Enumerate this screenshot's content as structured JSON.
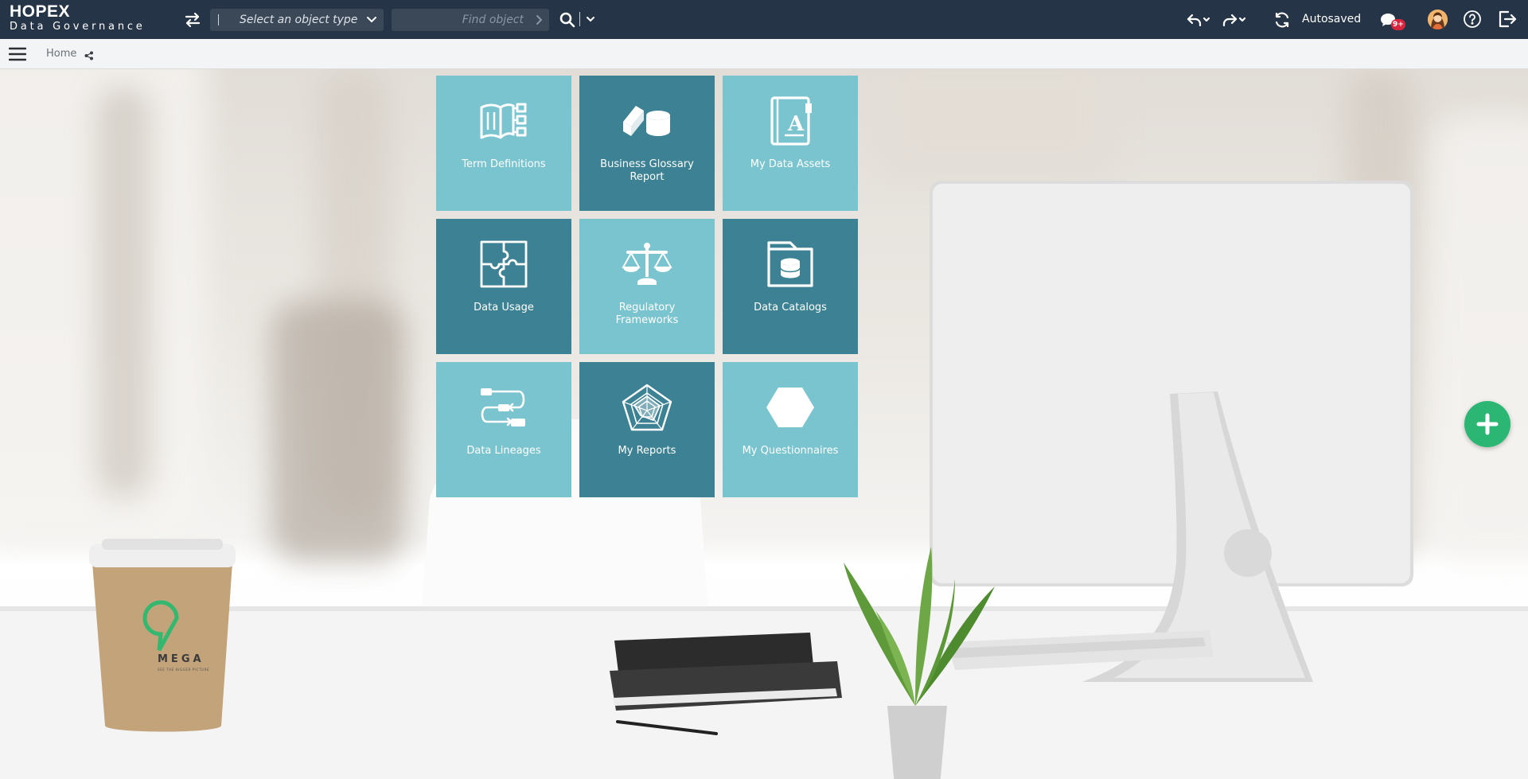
{
  "app": {
    "brand_name": "HOPEX",
    "brand_sub": "Data Governance"
  },
  "toolbar": {
    "object_type_placeholder": "Select an object type",
    "find_placeholder": "Find object",
    "autosaved_label": "Autosaved",
    "notification_badge": "9+"
  },
  "breadcrumb": {
    "home": "Home"
  },
  "tiles": [
    {
      "label": "Term Definitions",
      "icon": "book-list-icon",
      "shade": "light"
    },
    {
      "label": "Business Glossary Report",
      "icon": "books-database-icon",
      "shade": "dark"
    },
    {
      "label": "My Data Assets",
      "icon": "address-book-icon",
      "shade": "light"
    },
    {
      "label": "Data Usage",
      "icon": "puzzle-icon",
      "shade": "dark"
    },
    {
      "label": "Regulatory Frameworks",
      "icon": "scales-icon",
      "shade": "light"
    },
    {
      "label": "Data Catalogs",
      "icon": "folder-database-icon",
      "shade": "dark"
    },
    {
      "label": "Data Lineages",
      "icon": "flow-icon",
      "shade": "light"
    },
    {
      "label": "My Reports",
      "icon": "radar-chart-icon",
      "shade": "dark"
    },
    {
      "label": "My Questionnaires",
      "icon": "hexagon-icon",
      "shade": "light"
    }
  ],
  "colors": {
    "topbar": "#253447",
    "tile_light": "#7ac4cf",
    "tile_dark": "#3c8294",
    "fab": "#2bb673",
    "badge": "#d7263d"
  }
}
